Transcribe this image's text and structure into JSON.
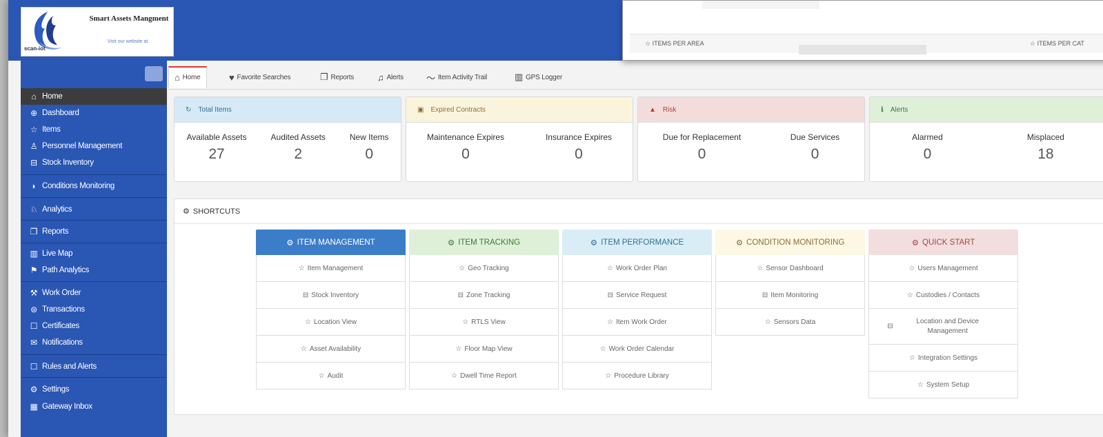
{
  "brand": {
    "title": "Smart Assets Mangment",
    "subtitle": "Visit our website at",
    "mark_text": "scan-iot"
  },
  "overlay": {
    "items_per_area": "ITEMS PER AREA",
    "items_per_category": "ITEMS PER CAT"
  },
  "sidebar": {
    "items": [
      {
        "label": "Home",
        "icon": "home-icon"
      },
      {
        "label": "Dashboard",
        "icon": "globe-icon"
      },
      {
        "label": "Items",
        "icon": "star-icon"
      },
      {
        "label": "Personnel Management",
        "icon": "users-icon"
      },
      {
        "label": "Stock Inventory",
        "icon": "inbox-icon"
      },
      {
        "label": "Conditions Monitoring",
        "icon": "signal-icon"
      },
      {
        "label": "Analytics",
        "icon": "analytics-icon"
      },
      {
        "label": "Reports",
        "icon": "reports-icon"
      },
      {
        "label": "Live Map",
        "icon": "map-icon"
      },
      {
        "label": "Path Analytics",
        "icon": "signpost-icon"
      },
      {
        "label": "Work Order",
        "icon": "wrench-icon"
      },
      {
        "label": "Transactions",
        "icon": "transactions-icon"
      },
      {
        "label": "Certificates",
        "icon": "certificate-icon"
      },
      {
        "label": "Notifications",
        "icon": "envelope-icon"
      },
      {
        "label": "Rules and Alerts",
        "icon": "rules-icon"
      },
      {
        "label": "Settings",
        "icon": "gear-icon"
      },
      {
        "label": "Gateway Inbox",
        "icon": "gateway-icon"
      }
    ]
  },
  "tabs": [
    {
      "label": "Home",
      "icon": "home-icon"
    },
    {
      "label": "Favorite Searches",
      "icon": "heart-icon"
    },
    {
      "label": "Reports",
      "icon": "reports-icon"
    },
    {
      "label": "Alerts",
      "icon": "bell-icon"
    },
    {
      "label": "Item Activity Trail",
      "icon": "trend-icon"
    },
    {
      "label": "GPS Logger",
      "icon": "map-icon"
    }
  ],
  "cards": [
    {
      "title": "Total Items",
      "icon": "refresh-icon",
      "stats": [
        {
          "label": "Available Assets",
          "value": "27"
        },
        {
          "label": "Audited Assets",
          "value": "2"
        },
        {
          "label": "New Items",
          "value": "0"
        }
      ]
    },
    {
      "title": "Expired Contracts",
      "icon": "calendar-icon",
      "stats": [
        {
          "label": "Maintenance Expires",
          "value": "0"
        },
        {
          "label": "Insurance Expires",
          "value": "0"
        }
      ]
    },
    {
      "title": "Risk",
      "icon": "warning-icon",
      "stats": [
        {
          "label": "Due for Replacement",
          "value": "0"
        },
        {
          "label": "Due Services",
          "value": "0"
        }
      ]
    },
    {
      "title": "Alerts",
      "icon": "info-icon",
      "stats": [
        {
          "label": "Alarmed",
          "value": "0"
        },
        {
          "label": "Misplaced",
          "value": "18"
        }
      ]
    }
  ],
  "shortcuts": {
    "title": "SHORTCUTS",
    "columns": [
      {
        "title": "ITEM MANAGEMENT",
        "items": [
          "Item Management",
          "Stock Inventory",
          "Location View",
          "Asset Availability",
          "Audit"
        ]
      },
      {
        "title": "ITEM TRACKING",
        "items": [
          "Geo Tracking",
          "Zone Tracking",
          "RTLS View",
          "Floor Map View",
          "Dwell Time Report"
        ]
      },
      {
        "title": "ITEM PERFORMANCE",
        "items": [
          "Work Order Plan",
          "Service Request",
          "Item Work Order",
          "Work Order Calendar",
          "Procedure Library"
        ]
      },
      {
        "title": "CONDITION MONITORING",
        "items": [
          "Sensor Dashboard",
          "Item Monitoring",
          "Sensors Data"
        ]
      },
      {
        "title": "QUICK START",
        "items": [
          "Users Management",
          "Custodies / Contacts",
          "Location and Device Management",
          "Integration Settings",
          "System Setup"
        ]
      }
    ]
  },
  "colors": {
    "primary": "#2a56b4",
    "total_items": "#d6e9f6",
    "expired_contracts": "#fbf4dc",
    "risk": "#f3dcdc",
    "alerts": "#dff0d8",
    "item_management": "#3b7dc9",
    "item_tracking": "#dff0d8",
    "item_performance": "#d9edf7",
    "condition_monitoring": "#fcf8e3",
    "quick_start": "#f2dede"
  }
}
